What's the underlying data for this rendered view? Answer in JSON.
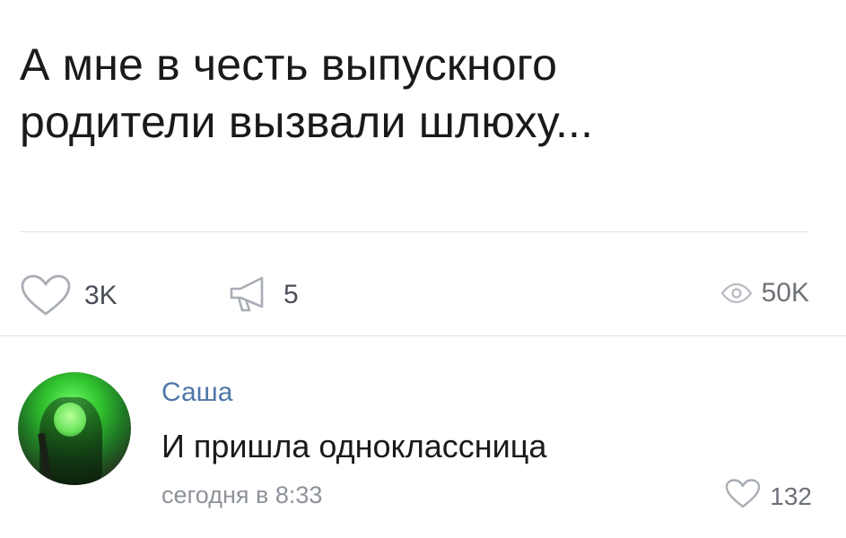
{
  "post": {
    "text_lines": [
      "А мне в честь выпускного",
      "родители вызвали шлюху..."
    ],
    "actions": {
      "likes": "3K",
      "shares": "5",
      "views": "50K"
    }
  },
  "comment": {
    "author": "Саша",
    "text": "И пришла одноклассница",
    "time": "сегодня в 8:33",
    "likes": "132"
  },
  "icons": {
    "like": "heart-icon",
    "share": "megaphone-icon",
    "views": "eye-icon",
    "comment_like": "heart-icon"
  },
  "colors": {
    "link": "#4f78a8",
    "secondary_text": "#8e939a",
    "icon_gray": "#a9aeb5",
    "divider": "#e3e4e8"
  }
}
